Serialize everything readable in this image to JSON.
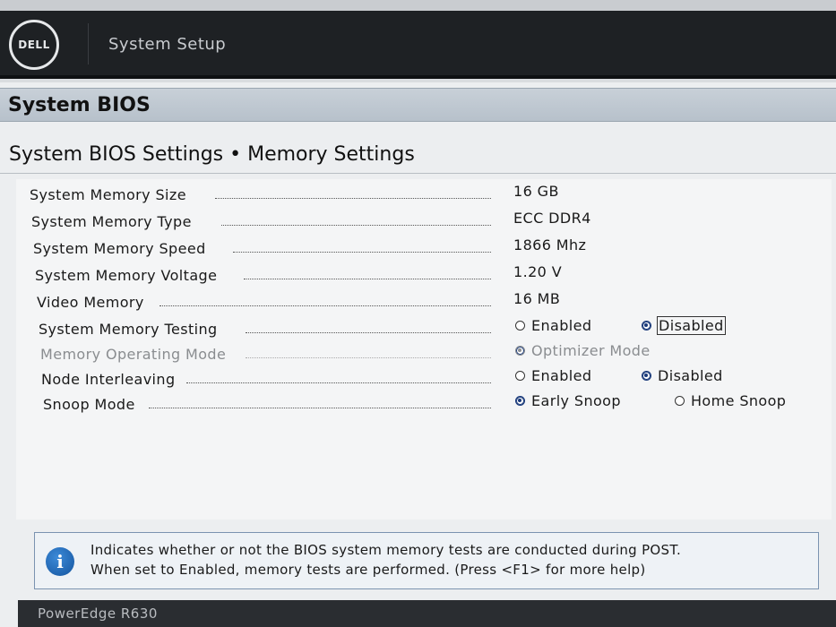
{
  "header": {
    "logo_text": "DELL",
    "title": "System Setup"
  },
  "section": {
    "title": "System BIOS"
  },
  "page": {
    "title": "System BIOS Settings • Memory Settings"
  },
  "rows": [
    {
      "label": "System Memory Size",
      "value": "16 GB"
    },
    {
      "label": "System Memory Type",
      "value": "ECC DDR4"
    },
    {
      "label": "System Memory Speed",
      "value": "1866 Mhz"
    },
    {
      "label": "System Memory Voltage",
      "value": "1.20 V"
    },
    {
      "label": "Video Memory",
      "value": "16 MB"
    },
    {
      "label": "System Memory Testing",
      "options": [
        "Enabled",
        "Disabled"
      ],
      "selected": "Disabled"
    },
    {
      "label": "Memory Operating Mode",
      "options": [
        "Optimizer Mode"
      ],
      "selected": "Optimizer Mode",
      "disabled": true
    },
    {
      "label": "Node Interleaving",
      "options": [
        "Enabled",
        "Disabled"
      ],
      "selected": "Disabled"
    },
    {
      "label": "Snoop Mode",
      "options": [
        "Early Snoop",
        "Home Snoop"
      ],
      "selected": "Early Snoop"
    }
  ],
  "help": {
    "icon": "info-icon",
    "line1": "Indicates whether or not the BIOS system memory tests are conducted during POST.",
    "line2": "When set to Enabled, memory tests are performed. (Press <F1> for more help)"
  },
  "footer": {
    "model": "PowerEdge R630"
  },
  "colors": {
    "header_bg": "#1e2124",
    "selected_radio": "#1a3a7a",
    "info_icon": "#14549e"
  }
}
